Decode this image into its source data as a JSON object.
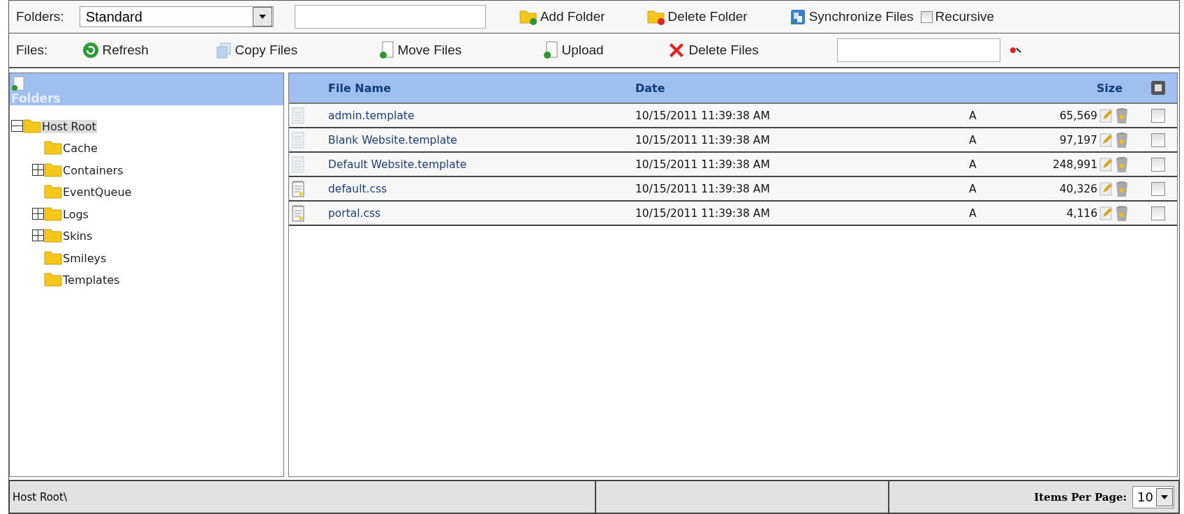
{
  "toolbar_folders": {
    "label": "Folders:",
    "folder_select": {
      "value": "Standard"
    },
    "actions": [
      {
        "kind": "add-folder",
        "label": "Add Folder"
      },
      {
        "kind": "delete-folder",
        "label": "Delete Folder"
      },
      {
        "kind": "sync",
        "label": "Synchronize Files"
      }
    ],
    "recursive": {
      "label": "Recursive",
      "checked": false
    }
  },
  "toolbar_files": {
    "label": "Files:",
    "actions": [
      {
        "kind": "refresh",
        "label": "Refresh"
      },
      {
        "kind": "copy",
        "label": "Copy Files"
      },
      {
        "kind": "move",
        "label": "Move Files"
      },
      {
        "kind": "upload",
        "label": "Upload"
      },
      {
        "kind": "delete",
        "label": "Delete Files"
      }
    ]
  },
  "tree": {
    "title": "Folders",
    "nodes": [
      {
        "label": "Host Root",
        "expanded": true,
        "selected": true,
        "children": [
          {
            "label": "Cache",
            "selected": false
          },
          {
            "label": "Containers",
            "expanded": false,
            "selected": false
          },
          {
            "label": "EventQueue",
            "selected": false
          },
          {
            "label": "Logs",
            "expanded": false,
            "selected": false
          },
          {
            "label": "Skins",
            "expanded": false,
            "selected": false
          },
          {
            "label": "Smileys",
            "selected": false
          },
          {
            "label": "Templates",
            "selected": false
          }
        ]
      }
    ]
  },
  "table": {
    "columns": [
      "File Name",
      "Date",
      "Size"
    ],
    "rows": [
      {
        "kind": "template",
        "name": "admin.template",
        "date": "10/15/2011 11:39:38 AM",
        "attr": "A",
        "size": "65,569",
        "checked": false
      },
      {
        "kind": "template",
        "name": "Blank Website.template",
        "date": "10/15/2011 11:39:38 AM",
        "attr": "A",
        "size": "97,197",
        "checked": false
      },
      {
        "kind": "template",
        "name": "Default Website.template",
        "date": "10/15/2011 11:39:38 AM",
        "attr": "A",
        "size": "248,991",
        "checked": false
      },
      {
        "kind": "css",
        "name": "default.css",
        "date": "10/15/2011 11:39:38 AM",
        "attr": "A",
        "size": "40,326",
        "checked": false
      },
      {
        "kind": "css",
        "name": "portal.css",
        "date": "10/15/2011 11:39:38 AM",
        "attr": "A",
        "size": "4,116",
        "checked": false
      }
    ]
  },
  "status_bar": {
    "path": "Host Root\\",
    "items_per_page_label": "Items Per Page:",
    "items_per_page": "10"
  }
}
